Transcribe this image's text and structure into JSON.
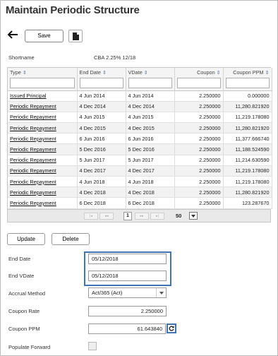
{
  "page": {
    "title": "Maintain Periodic Structure"
  },
  "toolbar": {
    "back_icon": "arrow-left-icon",
    "save_label": "Save",
    "doc_icon": "document-icon"
  },
  "shortname": {
    "label": "Shortname",
    "value": "CBA 2.25% 12/18"
  },
  "grid": {
    "columns": [
      "Type",
      "End Date",
      "VDate",
      "Coupon",
      "Coupon PPM"
    ],
    "rows": [
      [
        "Issued Principal",
        "4 Jun 2014",
        "4 Jun 2014",
        "2.250000",
        "0.000000"
      ],
      [
        "Periodic Repayment",
        "4 Dec 2014",
        "4 Dec 2014",
        "2.250000",
        "11,280.821920"
      ],
      [
        "Periodic Repayment",
        "4 Jun 2015",
        "4 Jun 2015",
        "2.250000",
        "11,219.178080"
      ],
      [
        "Periodic Repayment",
        "4 Dec 2015",
        "4 Dec 2015",
        "2.250000",
        "11,280.821920"
      ],
      [
        "Periodic Repayment",
        "6 Jun 2016",
        "6 Jun 2016",
        "2.250000",
        "11,377.666740"
      ],
      [
        "Periodic Repayment",
        "5 Dec 2016",
        "5 Dec 2016",
        "2.250000",
        "11,188.524590"
      ],
      [
        "Periodic Repayment",
        "5 Jun 2017",
        "5 Jun 2017",
        "2.250000",
        "11,214.630590"
      ],
      [
        "Periodic Repayment",
        "4 Dec 2017",
        "4 Dec 2017",
        "2.250000",
        "11,219.178080"
      ],
      [
        "Periodic Repayment",
        "4 Jun 2018",
        "4 Jun 2018",
        "2.250000",
        "11,219.178080"
      ],
      [
        "Periodic Repayment",
        "4 Dec 2018",
        "4 Dec 2018",
        "2.250000",
        "11,280.821920"
      ],
      [
        "Periodic Repayment",
        "6 Dec 2018",
        "6 Dec 2018",
        "2.250000",
        "123.287670"
      ]
    ],
    "pager": {
      "first": "|◂",
      "prev": "◂◂",
      "page": "1",
      "next": "▸▸",
      "last": "▸|",
      "page_size": "50"
    }
  },
  "actions": {
    "update_label": "Update",
    "delete_label": "Delete"
  },
  "form": {
    "end_date": {
      "label": "End Date",
      "value": "05/12/2018"
    },
    "end_vdate": {
      "label": "End VDate",
      "value": "05/12/2018"
    },
    "accrual_method": {
      "label": "Accrual Method",
      "value": "Act/365 (Act)"
    },
    "coupon_rate": {
      "label": "Coupon Rate",
      "value": "2.250000"
    },
    "coupon_ppm": {
      "label": "Coupon PPM",
      "value": "61.643840"
    },
    "populate_forward": {
      "label": "Populate Forward"
    }
  },
  "colors": {
    "highlight": "#3f74b5",
    "sort_arrow": "#5b7db2"
  }
}
